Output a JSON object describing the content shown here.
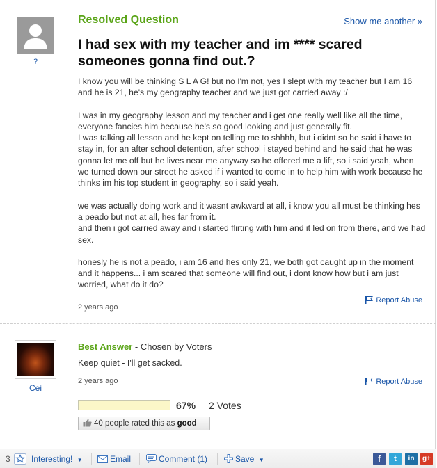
{
  "question": {
    "status": "Resolved Question",
    "show_another": "Show me another »",
    "title": "I had sex with my teacher and im **** scared someones gonna find out.?",
    "asker": "?",
    "paragraphs": [
      "I know you will be thinking S L A G! but no I'm not, yes I slept with my teacher but I am 16 and he is 21, he's my geography teacher and we just got carried away :/",
      "I was in my geography lesson and my teacher and i get one really well like all the time, everyone fancies him because he's so good looking and just generally fit.\nI was talking all lesson and he kept on telling me to shhhh, but i didnt so he said i have to stay in, for an after school detention, after school i stayed behind and he said that he was gonna let me off but he lives near me anyway so he offered me a lift, so i said yeah, when we turned down our street he asked if i wanted to come in to help him with work because he thinks im his top student in geography, so i said yeah.",
      "we was actually doing work and it wasnt awkward at all, i know you all must be thinking hes a peado but not at all, hes far from it.\nand then i got carried away and i started flirting with him and it led on from there, and we had sex.",
      "honesly he is not a peado, i am 16 and hes only 21, we both got caught up in the moment and it happens... i am scared that someone will find out, i dont know how but i am just worried, what do it do?"
    ],
    "time": "2 years ago",
    "report": "Report Abuse"
  },
  "answer": {
    "best_label": "Best Answer",
    "chosen_by": " - Chosen by Voters",
    "text": "Keep quiet - I'll get sacked.",
    "answerer": "Cei",
    "time": "2 years ago",
    "report": "Report Abuse",
    "vote_percent_value": 67,
    "vote_percent": "67%",
    "votes": "2 Votes",
    "rated_prefix": "40 people rated this as ",
    "rated_word": "good"
  },
  "bottom_bar": {
    "interesting_count": "3",
    "interesting": "Interesting!",
    "email": "Email",
    "comment": "Comment (1)",
    "save": "Save",
    "social": [
      "f",
      "t",
      "in",
      "g+"
    ]
  },
  "colors": {
    "link": "#1a56a8",
    "green": "#5ba519",
    "facebook": "#3b5998",
    "twitter": "#33a7d9",
    "linkedin": "#1d6fa5",
    "gplus": "#d63a25"
  }
}
